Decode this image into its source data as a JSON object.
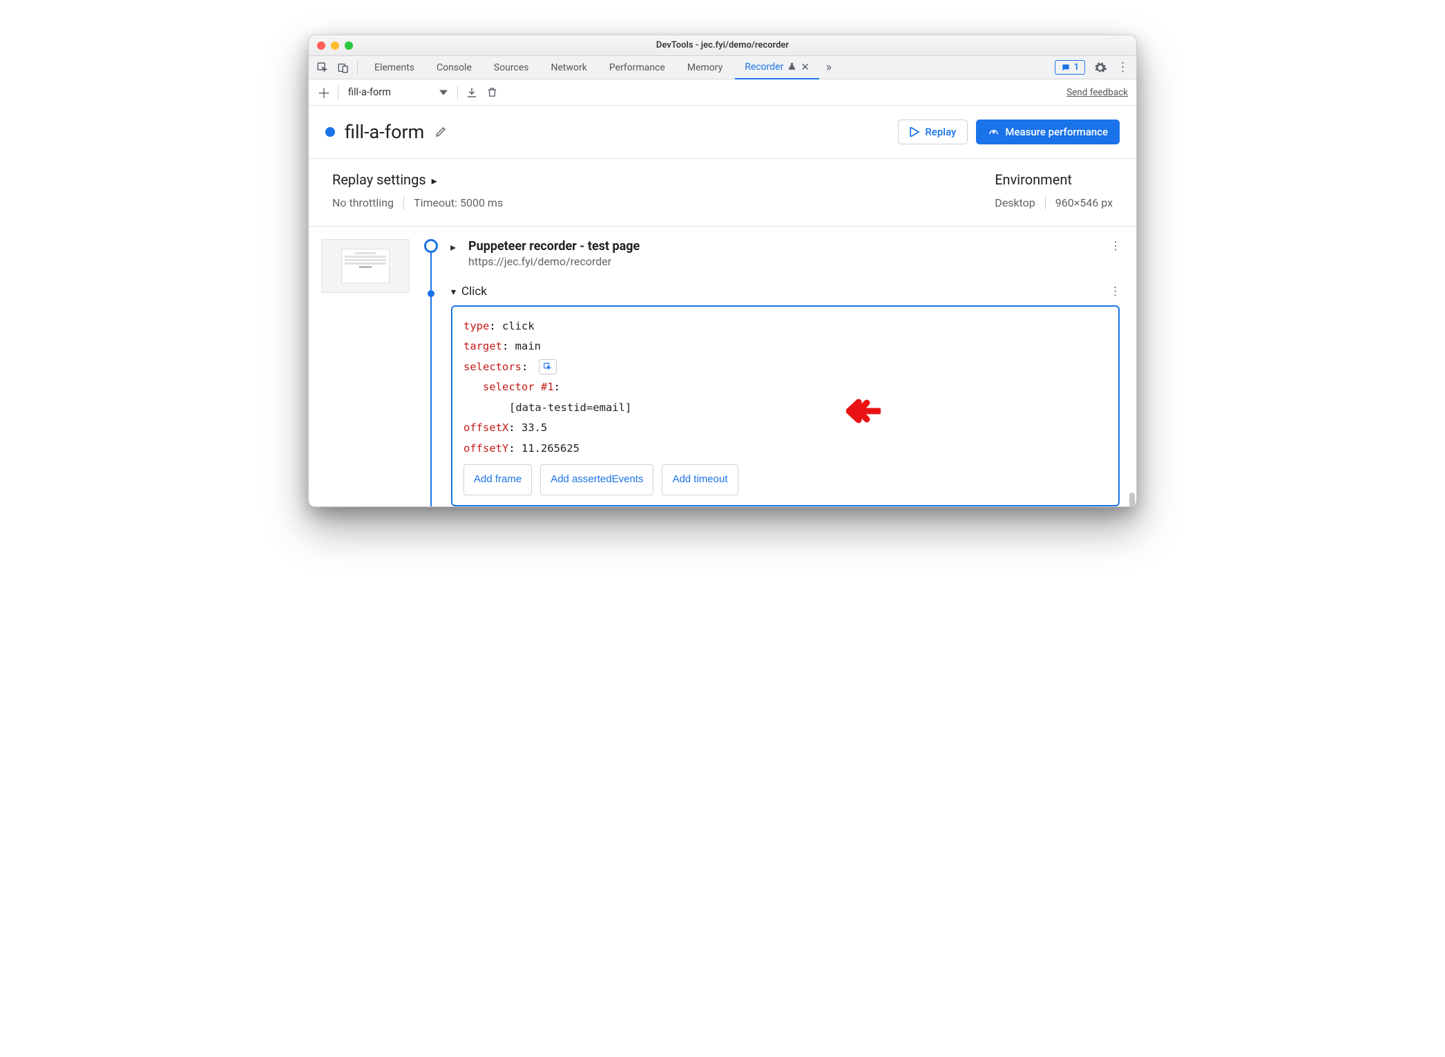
{
  "window": {
    "title": "DevTools - jec.fyi/demo/recorder"
  },
  "tabs": {
    "items": [
      "Elements",
      "Console",
      "Sources",
      "Network",
      "Performance",
      "Memory",
      "Recorder"
    ],
    "active": "Recorder",
    "issues_count": "1"
  },
  "toolbar": {
    "recording_name": "fill-a-form",
    "feedback": "Send feedback"
  },
  "header": {
    "title": "fill-a-form",
    "replay_label": "Replay",
    "measure_label": "Measure performance"
  },
  "settings": {
    "replay_heading": "Replay settings",
    "throttling": "No throttling",
    "timeout": "Timeout: 5000 ms",
    "env_heading": "Environment",
    "device": "Desktop",
    "dimensions": "960×546 px"
  },
  "step_initial": {
    "title": "Puppeteer recorder - test page",
    "url": "https://jec.fyi/demo/recorder"
  },
  "step_click": {
    "label": "Click",
    "type_key": "type",
    "type_val": "click",
    "target_key": "target",
    "target_val": "main",
    "selectors_key": "selectors",
    "selector_label": "selector #1",
    "selector_value": "[data-testid=email]",
    "offsetx_key": "offsetX",
    "offsetx_val": "33.5",
    "offsety_key": "offsetY",
    "offsety_val": "11.265625",
    "add_frame": "Add frame",
    "add_asserted": "Add assertedEvents",
    "add_timeout": "Add timeout"
  }
}
